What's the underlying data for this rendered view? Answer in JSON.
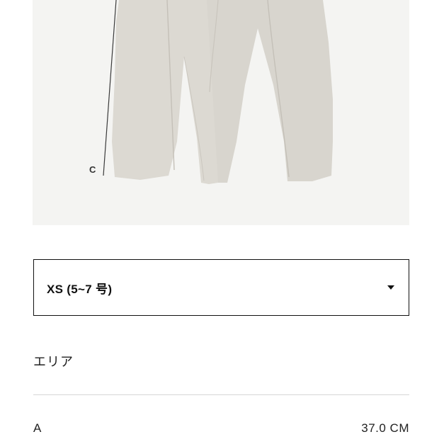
{
  "product": {
    "image_alt": "trousers-photo",
    "dimension_marker": "C"
  },
  "size_selector": {
    "selected": "XS (5~7 号)"
  },
  "measurement": {
    "section_label": "エリア",
    "rows": [
      {
        "label": "A",
        "value": "37.0 CM"
      }
    ]
  },
  "colors": {
    "image_bg": "#f4f4f2",
    "fabric": "#dcd9d2",
    "border": "#111111",
    "divider": "#d6d6d6"
  }
}
